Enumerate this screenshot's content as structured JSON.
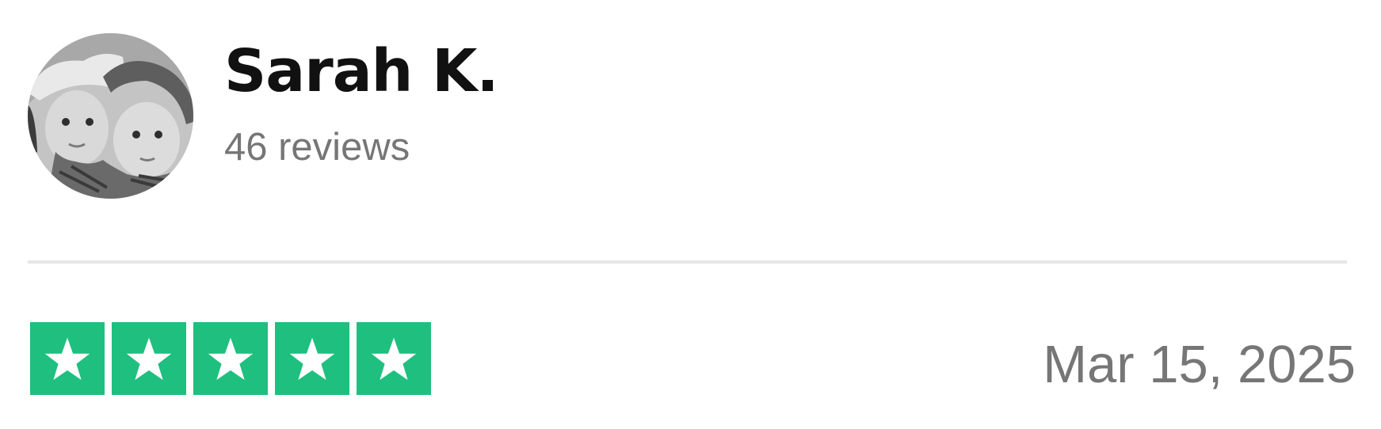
{
  "reviewer": {
    "name": "Sarah K.",
    "review_count": "46 reviews",
    "avatar_icon": "avatar-photo"
  },
  "review": {
    "rating": 5,
    "rating_max": 5,
    "star_color": "#1fbf7f",
    "date": "Mar 15, 2025"
  },
  "icons": {
    "star": "star-icon"
  }
}
